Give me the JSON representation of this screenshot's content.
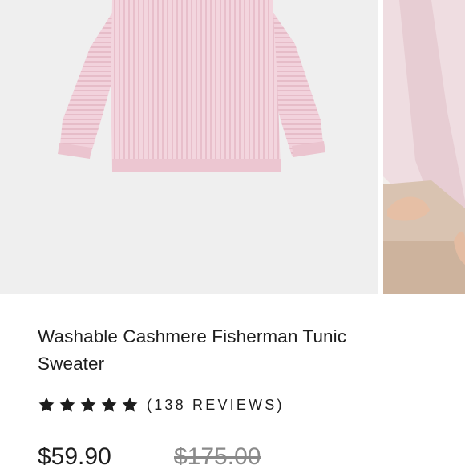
{
  "product": {
    "title": "Washable Cashmere Fisherman Tunic Sweater",
    "rating": {
      "stars": 5,
      "reviews_label": "138 REVIEWS"
    },
    "price": {
      "sale": "$59.90",
      "original": "$175.00"
    }
  },
  "images": [
    {
      "icon": "pink-sweater-product-photo"
    },
    {
      "icon": "sweater-worn-lifestyle-photo"
    }
  ],
  "colors": {
    "sweater_pink": "#f2d3dc",
    "background": "#efefef"
  }
}
